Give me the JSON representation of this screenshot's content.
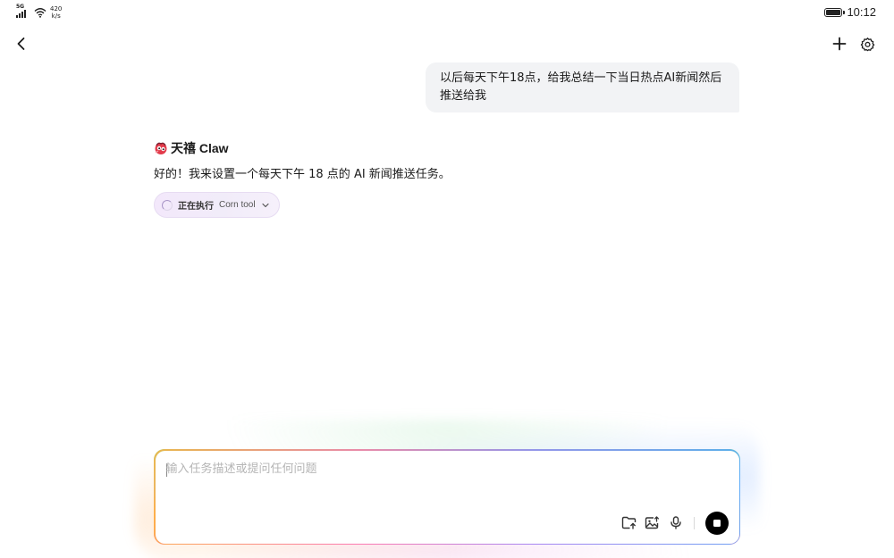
{
  "status_bar": {
    "network": "5G",
    "speed_value": "420",
    "speed_unit": "k/s",
    "time": "10:12"
  },
  "conversation": {
    "user_message": "以后每天下午18点，给我总结一下当日热点AI新闻然后推送给我",
    "assistant": {
      "name": "天禧 Claw",
      "message": "好的！我来设置一个每天下午 18 点的 AI 新闻推送任务。",
      "execution": {
        "status_label": "正在执行",
        "tool_name": "Corn tool"
      }
    }
  },
  "composer": {
    "placeholder": "输入任务描述或提问任何问题",
    "value": ""
  },
  "icons": {
    "back": "chevron-left-icon",
    "new_chat": "plus-icon",
    "settings": "gear-icon",
    "upload_file": "folder-upload-icon",
    "upload_image": "image-upload-icon",
    "voice": "microphone-icon",
    "stop": "stop-icon"
  },
  "colors": {
    "accent_text": "#1a1a1a",
    "bubble_bg": "#f2f3f5",
    "chip_bg": "#f3e8fb",
    "stop_button": "#000000"
  }
}
